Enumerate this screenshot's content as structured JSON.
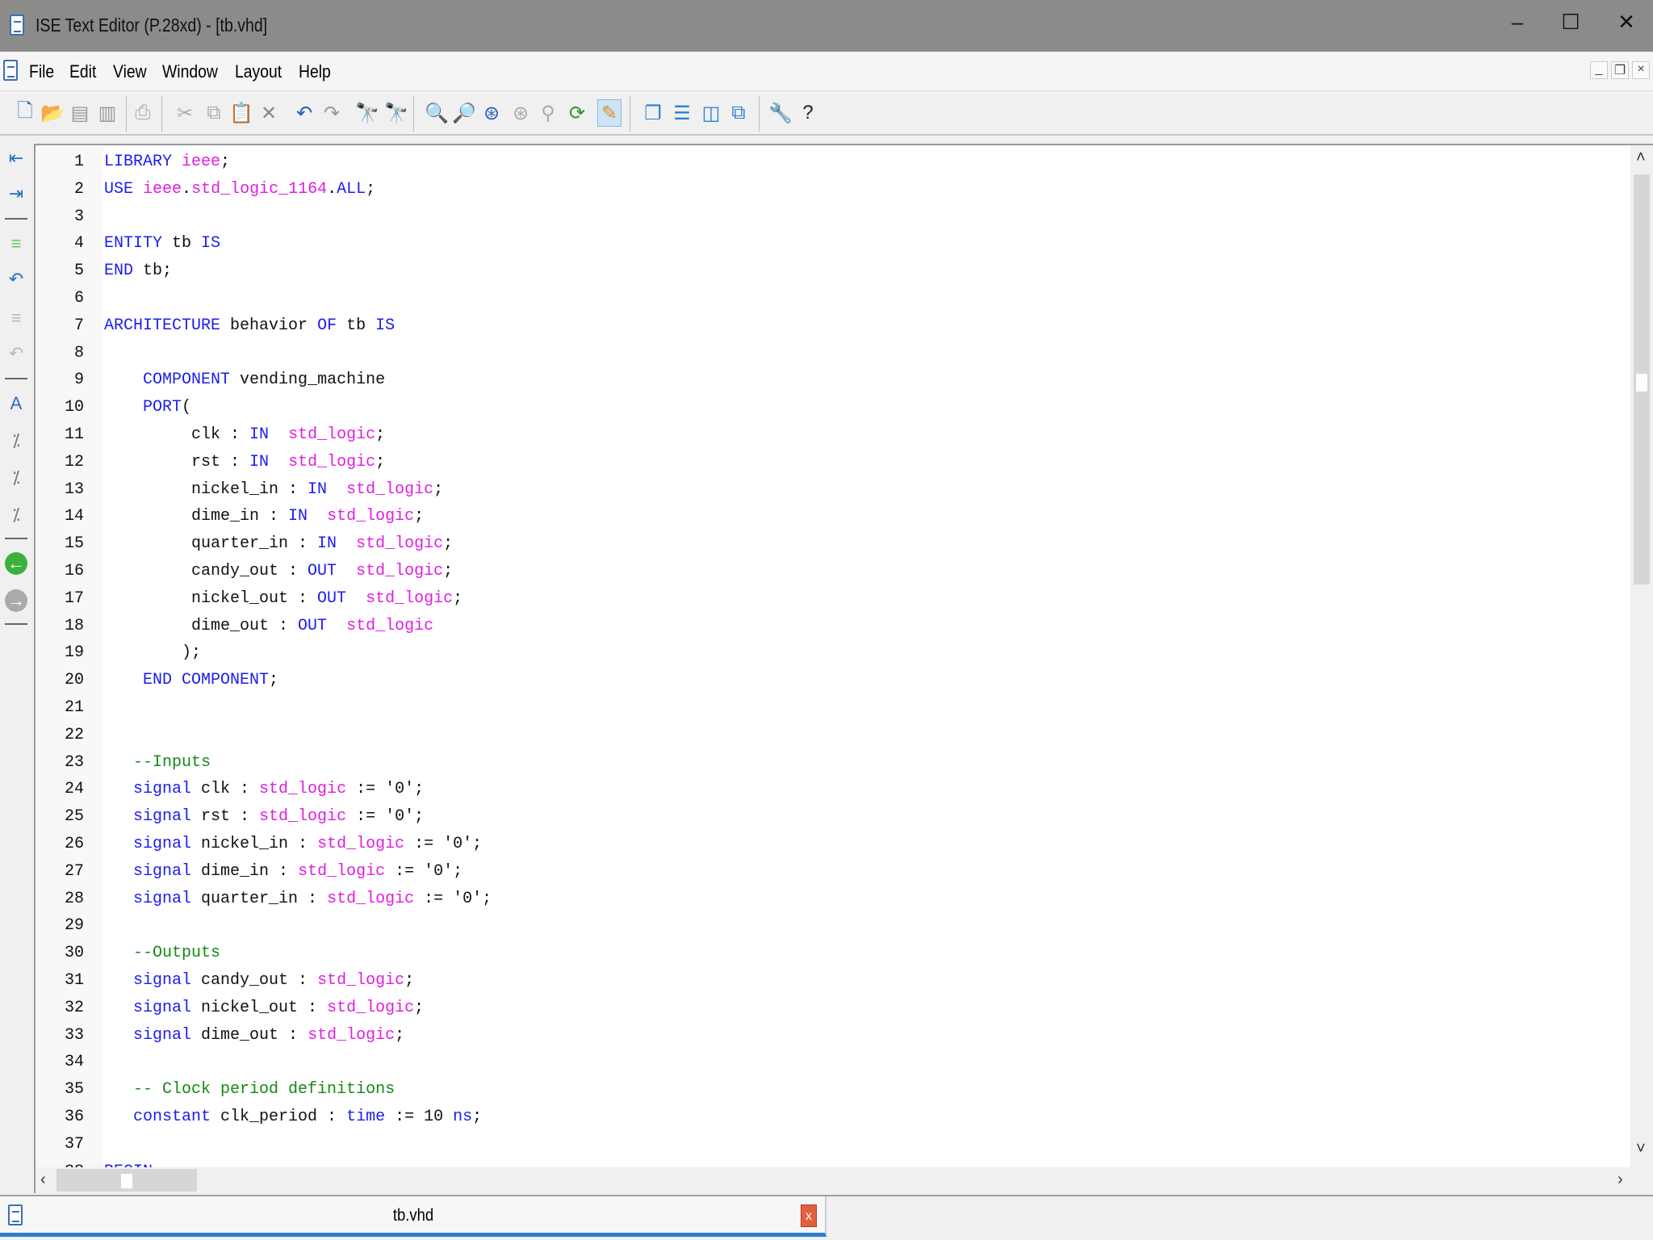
{
  "window": {
    "title": "ISE Text Editor (P.28xd) - [tb.vhd]",
    "minimize": "–",
    "maximize": "☐",
    "close": "✕"
  },
  "menu": [
    "File",
    "Edit",
    "View",
    "Window",
    "Layout",
    "Help"
  ],
  "tab": {
    "label": "tb.vhd",
    "close": "x"
  },
  "colors": {
    "keyword": "#1c1cf0",
    "type": "#e01ee0",
    "comment": "#148a14"
  },
  "lines": [
    [
      [
        "kw",
        "LIBRARY"
      ],
      [
        "tx",
        " "
      ],
      [
        "ty",
        "ieee"
      ],
      [
        "tx",
        ";"
      ]
    ],
    [
      [
        "kw",
        "USE"
      ],
      [
        "tx",
        " "
      ],
      [
        "ty",
        "ieee"
      ],
      [
        "tx",
        "."
      ],
      [
        "ty",
        "std_logic_1164"
      ],
      [
        "tx",
        "."
      ],
      [
        "kw",
        "ALL"
      ],
      [
        "tx",
        ";"
      ]
    ],
    [],
    [
      [
        "kw",
        "ENTITY"
      ],
      [
        "tx",
        " tb "
      ],
      [
        "kw",
        "IS"
      ]
    ],
    [
      [
        "kw",
        "END"
      ],
      [
        "tx",
        " tb;"
      ]
    ],
    [],
    [
      [
        "kw",
        "ARCHITECTURE"
      ],
      [
        "tx",
        " behavior "
      ],
      [
        "kw",
        "OF"
      ],
      [
        "tx",
        " tb "
      ],
      [
        "kw",
        "IS"
      ]
    ],
    [],
    [
      [
        "tx",
        "    "
      ],
      [
        "kw",
        "COMPONENT"
      ],
      [
        "tx",
        " vending_machine"
      ]
    ],
    [
      [
        "tx",
        "    "
      ],
      [
        "kw",
        "PORT"
      ],
      [
        "tx",
        "("
      ]
    ],
    [
      [
        "tx",
        "         clk : "
      ],
      [
        "kw",
        "IN"
      ],
      [
        "tx",
        "  "
      ],
      [
        "ty",
        "std_logic"
      ],
      [
        "tx",
        ";"
      ]
    ],
    [
      [
        "tx",
        "         rst : "
      ],
      [
        "kw",
        "IN"
      ],
      [
        "tx",
        "  "
      ],
      [
        "ty",
        "std_logic"
      ],
      [
        "tx",
        ";"
      ]
    ],
    [
      [
        "tx",
        "         nickel_in : "
      ],
      [
        "kw",
        "IN"
      ],
      [
        "tx",
        "  "
      ],
      [
        "ty",
        "std_logic"
      ],
      [
        "tx",
        ";"
      ]
    ],
    [
      [
        "tx",
        "         dime_in : "
      ],
      [
        "kw",
        "IN"
      ],
      [
        "tx",
        "  "
      ],
      [
        "ty",
        "std_logic"
      ],
      [
        "tx",
        ";"
      ]
    ],
    [
      [
        "tx",
        "         quarter_in : "
      ],
      [
        "kw",
        "IN"
      ],
      [
        "tx",
        "  "
      ],
      [
        "ty",
        "std_logic"
      ],
      [
        "tx",
        ";"
      ]
    ],
    [
      [
        "tx",
        "         candy_out : "
      ],
      [
        "kw",
        "OUT"
      ],
      [
        "tx",
        "  "
      ],
      [
        "ty",
        "std_logic"
      ],
      [
        "tx",
        ";"
      ]
    ],
    [
      [
        "tx",
        "         nickel_out : "
      ],
      [
        "kw",
        "OUT"
      ],
      [
        "tx",
        "  "
      ],
      [
        "ty",
        "std_logic"
      ],
      [
        "tx",
        ";"
      ]
    ],
    [
      [
        "tx",
        "         dime_out : "
      ],
      [
        "kw",
        "OUT"
      ],
      [
        "tx",
        "  "
      ],
      [
        "ty",
        "std_logic"
      ]
    ],
    [
      [
        "tx",
        "        );"
      ]
    ],
    [
      [
        "tx",
        "    "
      ],
      [
        "kw",
        "END COMPONENT"
      ],
      [
        "tx",
        ";"
      ]
    ],
    [],
    [],
    [
      [
        "tx",
        "   "
      ],
      [
        "cm",
        "--Inputs"
      ]
    ],
    [
      [
        "tx",
        "   "
      ],
      [
        "kw",
        "signal"
      ],
      [
        "tx",
        " clk : "
      ],
      [
        "ty",
        "std_logic"
      ],
      [
        "tx",
        " := '0';"
      ]
    ],
    [
      [
        "tx",
        "   "
      ],
      [
        "kw",
        "signal"
      ],
      [
        "tx",
        " rst : "
      ],
      [
        "ty",
        "std_logic"
      ],
      [
        "tx",
        " := '0';"
      ]
    ],
    [
      [
        "tx",
        "   "
      ],
      [
        "kw",
        "signal"
      ],
      [
        "tx",
        " nickel_in : "
      ],
      [
        "ty",
        "std_logic"
      ],
      [
        "tx",
        " := '0';"
      ]
    ],
    [
      [
        "tx",
        "   "
      ],
      [
        "kw",
        "signal"
      ],
      [
        "tx",
        " dime_in : "
      ],
      [
        "ty",
        "std_logic"
      ],
      [
        "tx",
        " := '0';"
      ]
    ],
    [
      [
        "tx",
        "   "
      ],
      [
        "kw",
        "signal"
      ],
      [
        "tx",
        " quarter_in : "
      ],
      [
        "ty",
        "std_logic"
      ],
      [
        "tx",
        " := '0';"
      ]
    ],
    [],
    [
      [
        "tx",
        "   "
      ],
      [
        "cm",
        "--Outputs"
      ]
    ],
    [
      [
        "tx",
        "   "
      ],
      [
        "kw",
        "signal"
      ],
      [
        "tx",
        " candy_out : "
      ],
      [
        "ty",
        "std_logic"
      ],
      [
        "tx",
        ";"
      ]
    ],
    [
      [
        "tx",
        "   "
      ],
      [
        "kw",
        "signal"
      ],
      [
        "tx",
        " nickel_out : "
      ],
      [
        "ty",
        "std_logic"
      ],
      [
        "tx",
        ";"
      ]
    ],
    [
      [
        "tx",
        "   "
      ],
      [
        "kw",
        "signal"
      ],
      [
        "tx",
        " dime_out : "
      ],
      [
        "ty",
        "std_logic"
      ],
      [
        "tx",
        ";"
      ]
    ],
    [],
    [
      [
        "tx",
        "   "
      ],
      [
        "cm",
        "-- Clock period definitions"
      ]
    ],
    [
      [
        "tx",
        "   "
      ],
      [
        "kw",
        "constant"
      ],
      [
        "tx",
        " clk_period : "
      ],
      [
        "kw",
        "time"
      ],
      [
        "tx",
        " := 10 "
      ],
      [
        "kw",
        "ns"
      ],
      [
        "tx",
        ";"
      ]
    ],
    [],
    [
      [
        "kw",
        "BEGIN"
      ]
    ]
  ]
}
